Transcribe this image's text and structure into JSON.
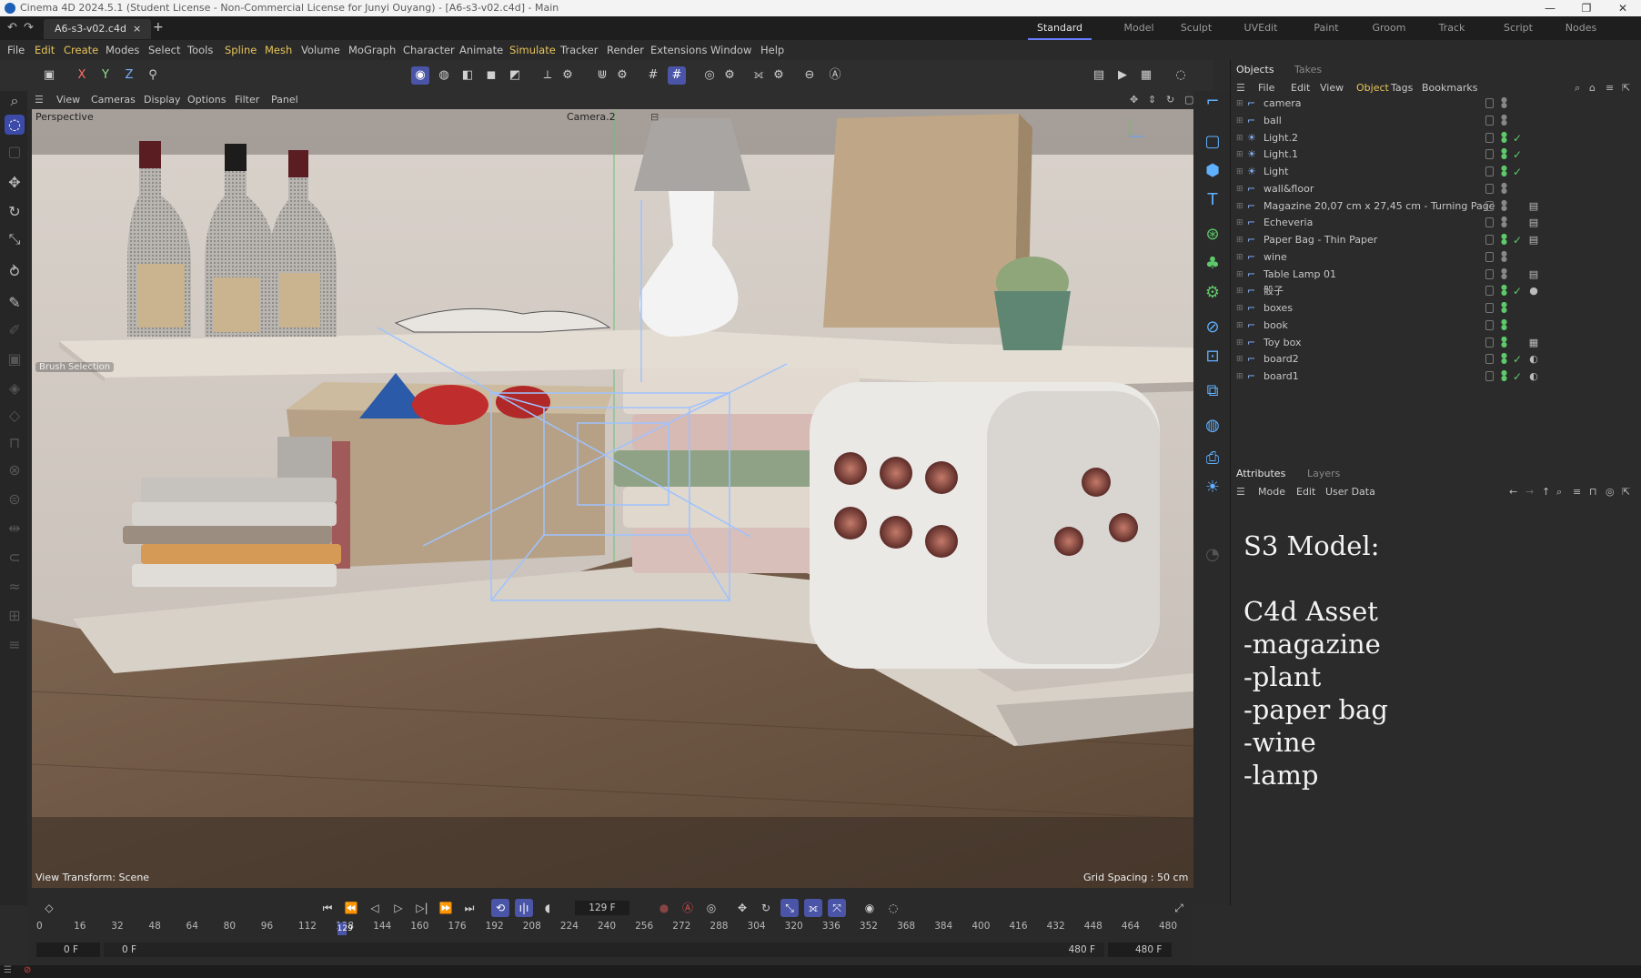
{
  "window": {
    "title": "Cinema 4D 2024.5.1 (Student License - Non-Commercial License for Junyi Ouyang) - [A6-s3-v02.c4d] - Main"
  },
  "doc_tab": {
    "label": "A6-s3-v02.c4d",
    "close": "×",
    "add": "+"
  },
  "layout_tabs": [
    "Standard",
    "Model",
    "Sculpt",
    "UVEdit",
    "Paint",
    "Groom",
    "Track",
    "Script",
    "Nodes"
  ],
  "menu": [
    "File",
    "Edit",
    "Create",
    "Modes",
    "Select",
    "Tools",
    "Spline",
    "Mesh",
    "Volume",
    "MoGraph",
    "Character",
    "Animate",
    "Simulate",
    "Tracker",
    "Render",
    "Extensions",
    "Window",
    "Help"
  ],
  "axis_toggles": [
    "X",
    "Y",
    "Z"
  ],
  "viewport": {
    "menu": [
      "View",
      "Cameras",
      "Display",
      "Options",
      "Filter",
      "Panel"
    ],
    "label": "Perspective",
    "camera": "Camera.2",
    "brush_selection": "Brush Selection",
    "view_transform": "View Transform: Scene",
    "grid_spacing": "Grid Spacing : 50 cm"
  },
  "objects_panel": {
    "tabs": [
      "Objects",
      "Takes"
    ],
    "menu": [
      "File",
      "Edit",
      "View",
      "Object",
      "Tags",
      "Bookmarks"
    ],
    "items": [
      {
        "name": "camera",
        "check": "",
        "tag": ""
      },
      {
        "name": "ball",
        "check": "",
        "tag": ""
      },
      {
        "name": "Light.2",
        "check": "✓",
        "tag": ""
      },
      {
        "name": "Light.1",
        "check": "✓",
        "tag": ""
      },
      {
        "name": "Light",
        "check": "✓",
        "tag": ""
      },
      {
        "name": "wall&floor",
        "check": "",
        "tag": ""
      },
      {
        "name": "Magazine 20,07 cm x 27,45 cm - Turning Page",
        "check": "",
        "tag": "▤"
      },
      {
        "name": "Echeveria",
        "check": "",
        "tag": "▤"
      },
      {
        "name": "Paper Bag - Thin Paper",
        "check": "✓",
        "tag": "▤"
      },
      {
        "name": "wine",
        "check": "",
        "tag": ""
      },
      {
        "name": "Table Lamp 01",
        "check": "",
        "tag": "▤"
      },
      {
        "name": "骰子",
        "check": "✓",
        "tag": "●"
      },
      {
        "name": "boxes",
        "check": "",
        "tag": ""
      },
      {
        "name": "book",
        "check": "",
        "tag": ""
      },
      {
        "name": "Toy box",
        "check": "",
        "tag": "▦"
      },
      {
        "name": "board2",
        "check": "✓",
        "tag": "◐"
      },
      {
        "name": "board1",
        "check": "✓",
        "tag": "◐"
      }
    ]
  },
  "attributes_panel": {
    "tabs": [
      "Attributes",
      "Layers"
    ],
    "menu": [
      "Mode",
      "Edit",
      "User Data"
    ],
    "notes": [
      "S3 Model:",
      "",
      "C4d Asset",
      "-magazine",
      "-plant",
      "-paper bag",
      "-wine",
      "-lamp"
    ]
  },
  "timeline": {
    "current_frame": "129 F",
    "ticks": [
      "0",
      "16",
      "32",
      "48",
      "64",
      "80",
      "96",
      "112",
      "128",
      "144",
      "160",
      "176",
      "192",
      "208",
      "224",
      "240",
      "256",
      "272",
      "288",
      "304",
      "320",
      "336",
      "352",
      "368",
      "384",
      "400",
      "416",
      "432",
      "448",
      "464",
      "480"
    ],
    "playhead_label": "129",
    "start_frame": "0 F",
    "preview_start": "0 F",
    "preview_end": "480 F",
    "end_frame": "480 F",
    "playhead_frame": 129,
    "max_frame": 480
  },
  "colors": {
    "accent": "#4a55a8",
    "highlight_menu": "#e7c45a",
    "check_green": "#5ec96a"
  }
}
